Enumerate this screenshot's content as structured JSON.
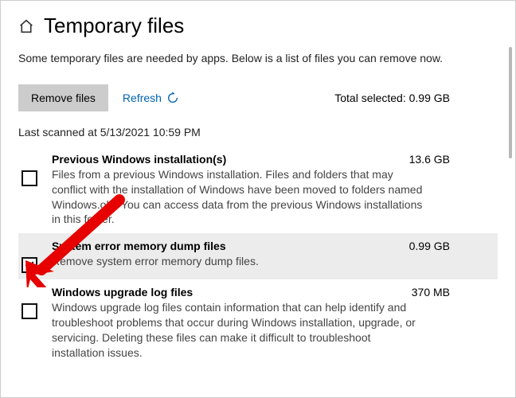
{
  "header": {
    "title": "Temporary files"
  },
  "intro": "Some temporary files are needed by apps. Below is a list of files you can remove now.",
  "actions": {
    "remove_label": "Remove files",
    "refresh_label": "Refresh",
    "total_label": "Total selected: 0.99 GB"
  },
  "last_scanned": "Last scanned at 5/13/2021 10:59 PM",
  "items": [
    {
      "title": "Previous Windows installation(s)",
      "size": "13.6 GB",
      "desc": "Files from a previous Windows installation.  Files and folders that may conflict with the installation of Windows have been moved to folders named Windows.old.  You can access data from the previous Windows installations in this folder.",
      "checked": false
    },
    {
      "title": "System error memory dump files",
      "size": "0.99 GB",
      "desc": "Remove system error memory dump files.",
      "checked": true
    },
    {
      "title": "Windows upgrade log files",
      "size": "370 MB",
      "desc": "Windows upgrade log files contain information that can help identify and troubleshoot problems that occur during Windows installation, upgrade, or servicing.  Deleting these files can make it difficult to troubleshoot installation issues.",
      "checked": false
    }
  ]
}
